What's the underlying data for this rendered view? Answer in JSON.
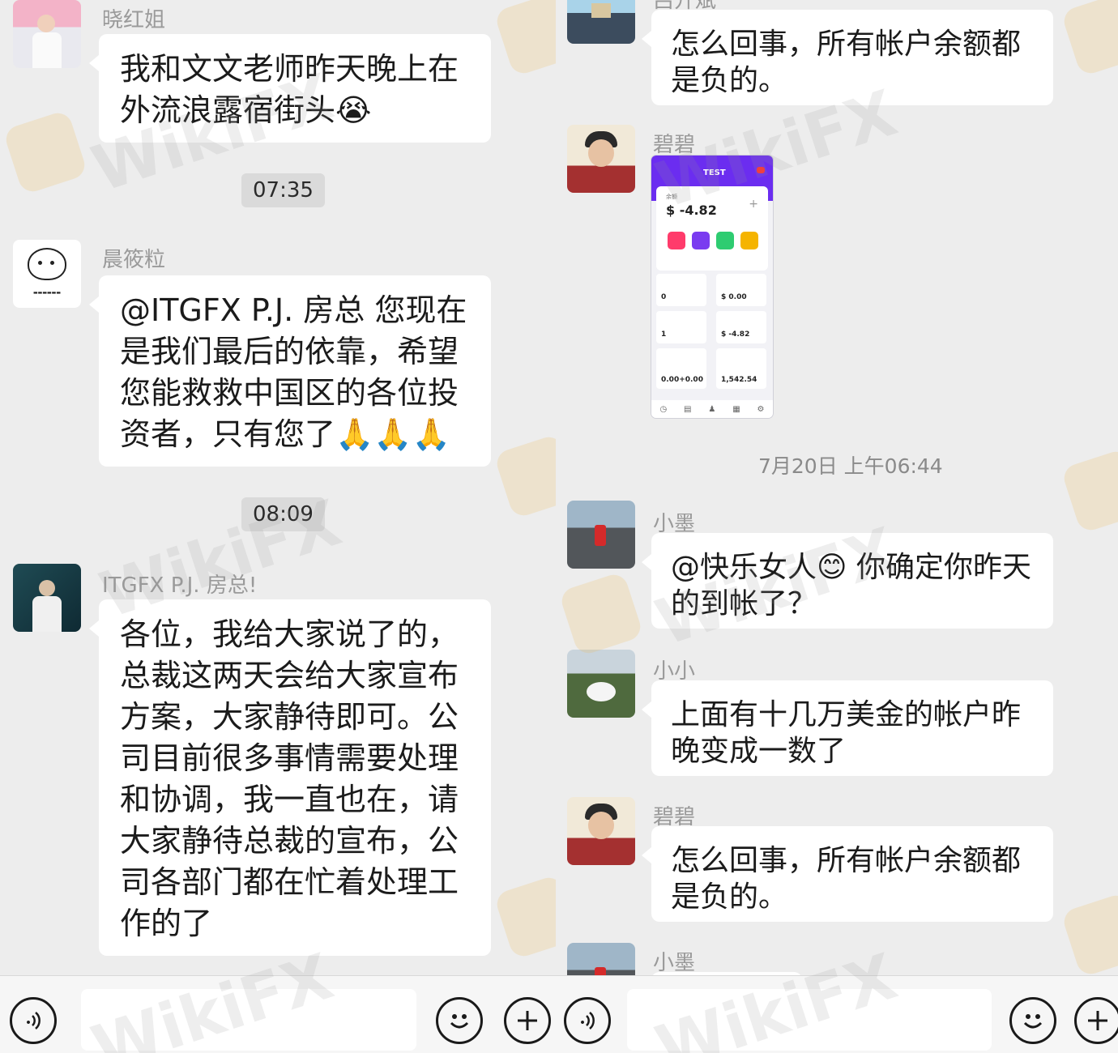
{
  "left_panel": {
    "messages": [
      {
        "sender": "晓红姐",
        "text": "我和文文老师昨天晚上在外流浪露宿街头😭"
      },
      {
        "timestamp": "07:35"
      },
      {
        "sender": "晨筱粒",
        "text": "@ITGFX P.J. 房总  您现在是我们最后的依靠，希望您能救救中国区的各位投资者，只有您了🙏🙏🙏"
      },
      {
        "timestamp": "08:09"
      },
      {
        "sender": "ITGFX P.J. 房总!",
        "text": "各位，我给大家说了的，总裁这两天会给大家宣布方案，大家静待即可。公司目前很多事情需要处理和协调，我一直也在，请大家静待总裁的宣布，公司各部门都在忙着处理工作的了"
      }
    ]
  },
  "right_panel": {
    "messages": [
      {
        "sender": "吕开斌",
        "text": "怎么回事，所有帐户余额都是负的。"
      },
      {
        "sender": "碧碧"
      },
      {
        "timestamp": "7月20日 上午06:44"
      },
      {
        "sender": "小墨",
        "text": "@快乐女人😊 你确定你昨天的到帐了？"
      },
      {
        "sender": "小小",
        "text": "上面有十几万美金的帐户昨晚变成一数了"
      },
      {
        "sender": "碧碧",
        "text": "怎么回事，所有帐户余额都是负的。"
      },
      {
        "sender": "小墨"
      }
    ],
    "app_screenshot": {
      "header": "TEST",
      "balance_label": "余额",
      "balance": "$ -4.82",
      "tiles": [
        "0",
        "$ 0.00",
        "1",
        "$ -4.82",
        "0.00+0.00",
        "1,542.54"
      ]
    }
  },
  "watermark": "WikiFX",
  "icons": [
    "voice-icon",
    "emoji-icon",
    "plus-icon"
  ],
  "colors": {
    "bubble": "#ffffff",
    "background": "#ededed",
    "app_header": "#6b2df0"
  }
}
